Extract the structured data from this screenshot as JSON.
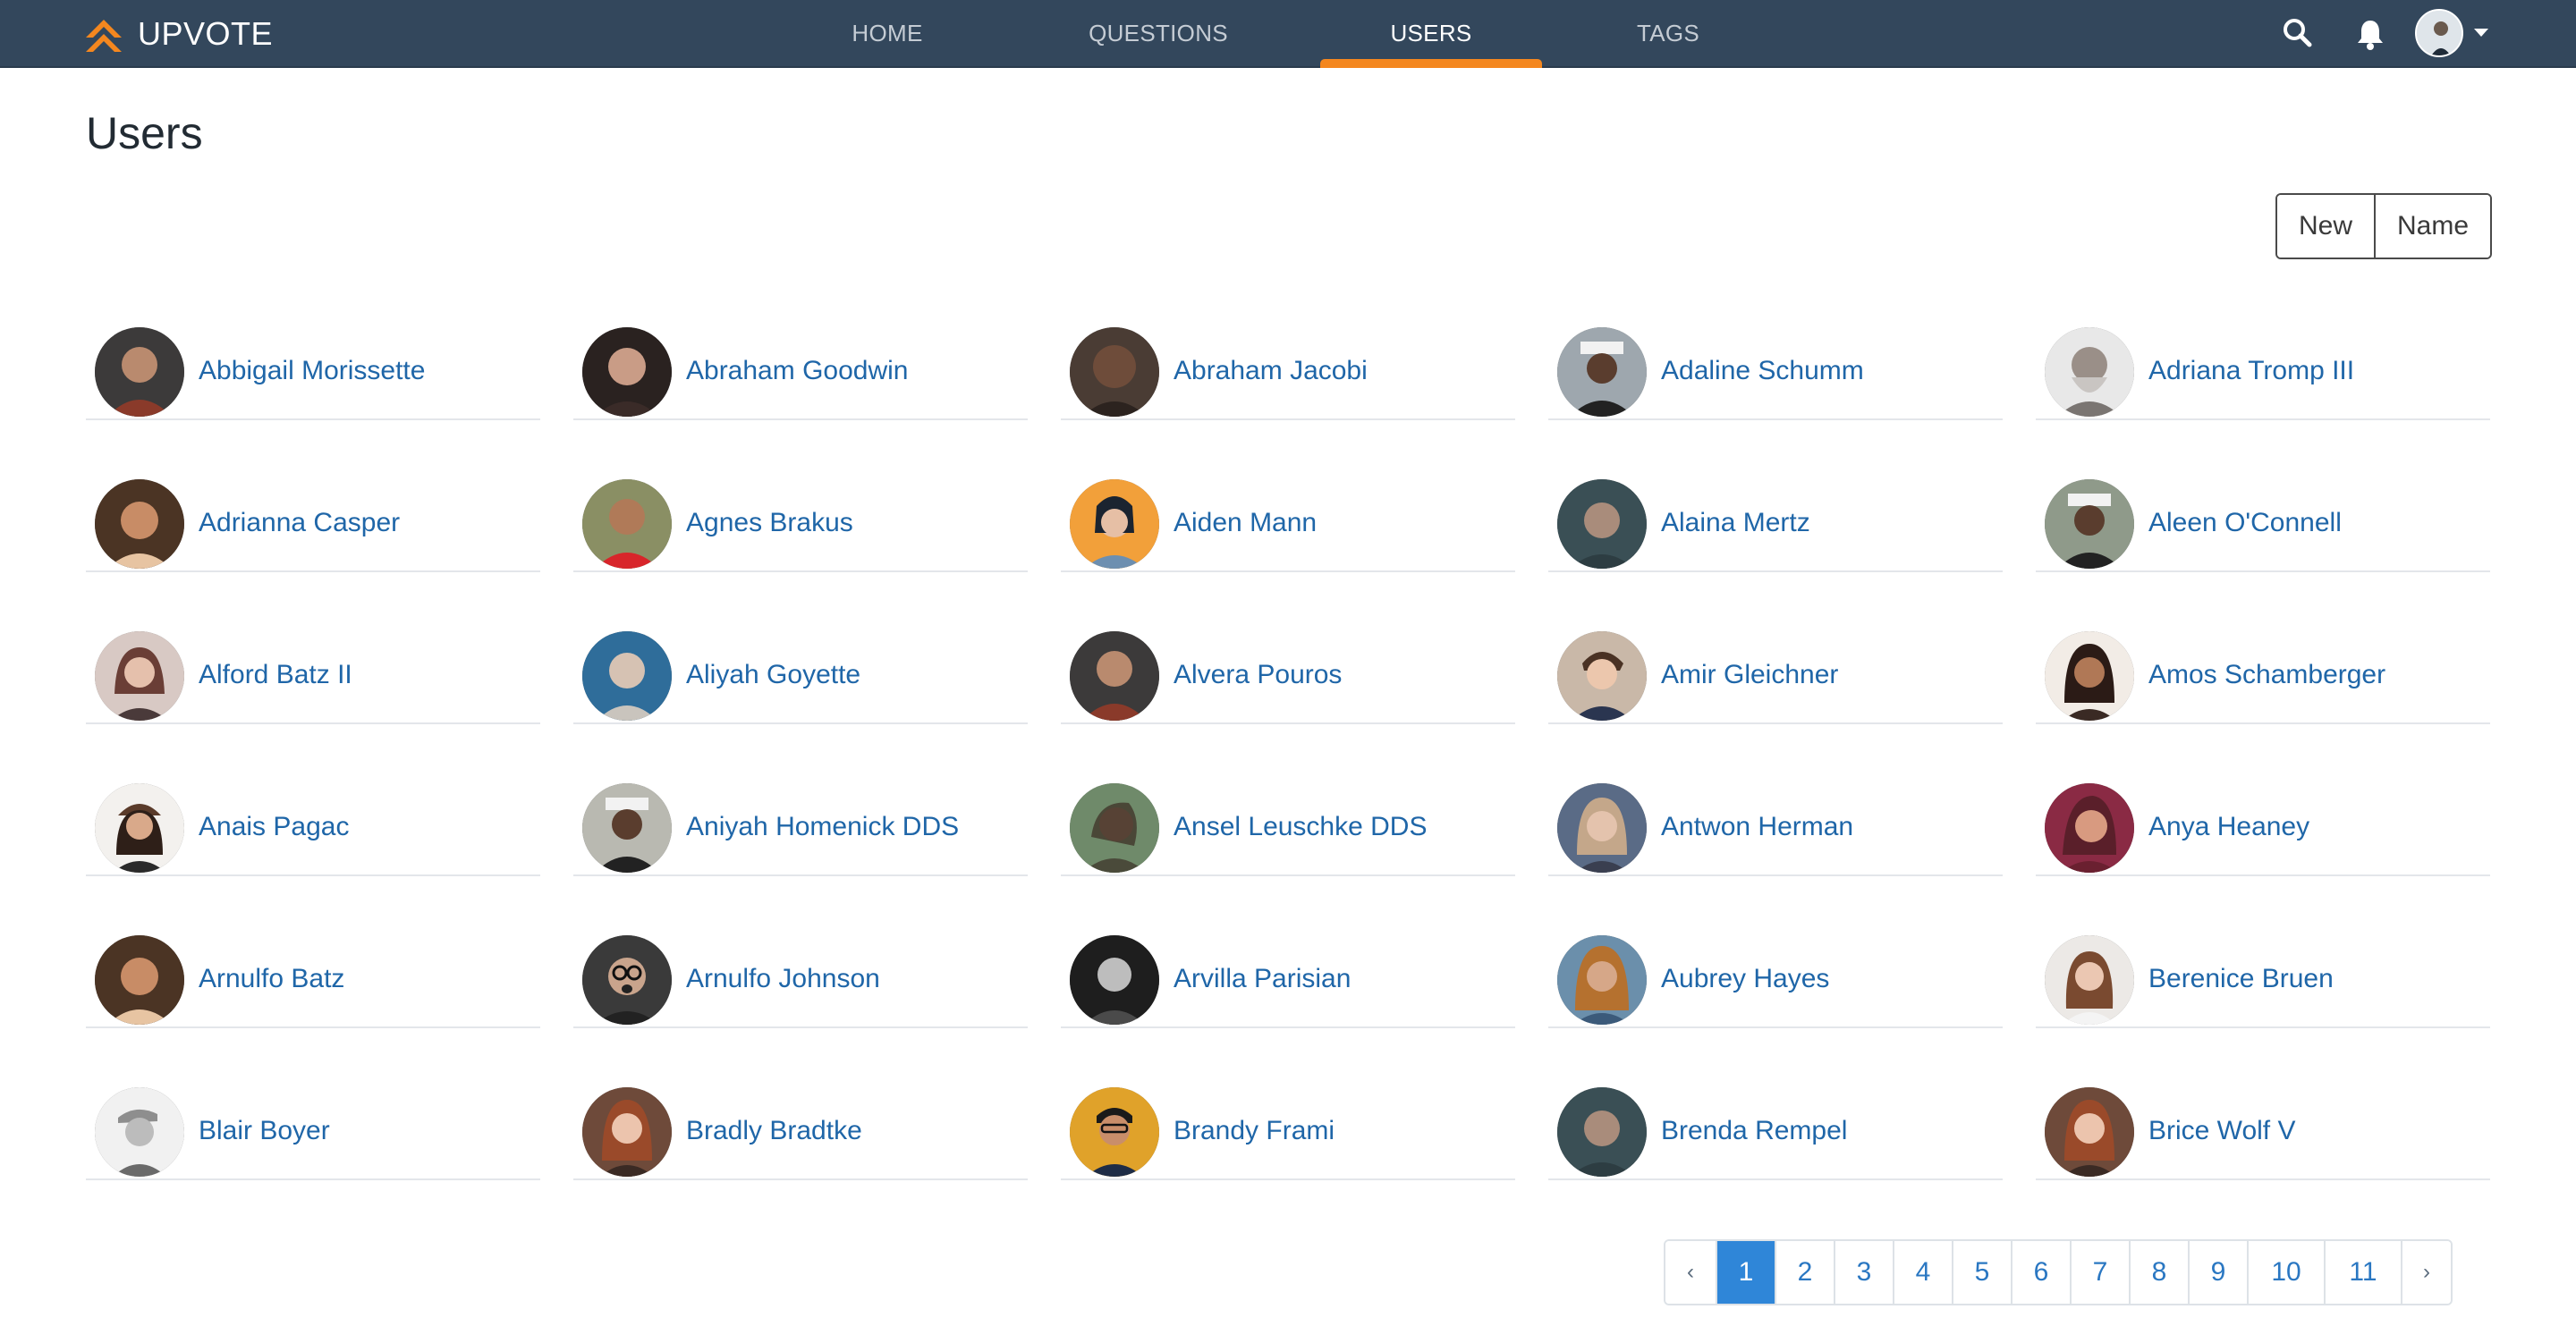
{
  "app": {
    "brand": "UPVOTE"
  },
  "nav": {
    "items": [
      {
        "label": "HOME",
        "active": false
      },
      {
        "label": "QUESTIONS",
        "active": false
      },
      {
        "label": "USERS",
        "active": true
      },
      {
        "label": "TAGS",
        "active": false
      }
    ],
    "icons": [
      "search-icon",
      "bell-icon",
      "user-avatar",
      "caret-down-icon"
    ]
  },
  "page": {
    "title": "Users"
  },
  "sort": {
    "new_label": "New",
    "name_label": "Name"
  },
  "users": [
    {
      "name": "Abbigail Morissette"
    },
    {
      "name": "Abraham Goodwin"
    },
    {
      "name": "Abraham Jacobi"
    },
    {
      "name": "Adaline Schumm"
    },
    {
      "name": "Adriana Tromp III"
    },
    {
      "name": "Adrianna Casper"
    },
    {
      "name": "Agnes Brakus"
    },
    {
      "name": "Aiden Mann"
    },
    {
      "name": "Alaina Mertz"
    },
    {
      "name": "Aleen O'Connell"
    },
    {
      "name": "Alford Batz II"
    },
    {
      "name": "Aliyah Goyette"
    },
    {
      "name": "Alvera Pouros"
    },
    {
      "name": "Amir Gleichner"
    },
    {
      "name": "Amos Schamberger"
    },
    {
      "name": "Anais Pagac"
    },
    {
      "name": "Aniyah Homenick DDS"
    },
    {
      "name": "Ansel Leuschke DDS"
    },
    {
      "name": "Antwon Herman"
    },
    {
      "name": "Anya Heaney"
    },
    {
      "name": "Arnulfo Batz"
    },
    {
      "name": "Arnulfo Johnson"
    },
    {
      "name": "Arvilla Parisian"
    },
    {
      "name": "Aubrey Hayes"
    },
    {
      "name": "Berenice Bruen"
    },
    {
      "name": "Blair Boyer"
    },
    {
      "name": "Bradly Bradtke"
    },
    {
      "name": "Brandy Frami"
    },
    {
      "name": "Brenda Rempel"
    },
    {
      "name": "Brice Wolf V"
    }
  ],
  "pagination": {
    "prev_label": "‹",
    "next_label": "›",
    "pages": [
      "1",
      "2",
      "3",
      "4",
      "5",
      "6",
      "7",
      "8",
      "9",
      "10",
      "11"
    ],
    "current": "1"
  },
  "colors": {
    "navbar": "#33475c",
    "accent": "#f4871f",
    "link": "#1f66a8",
    "active_page": "#2f86d8"
  }
}
